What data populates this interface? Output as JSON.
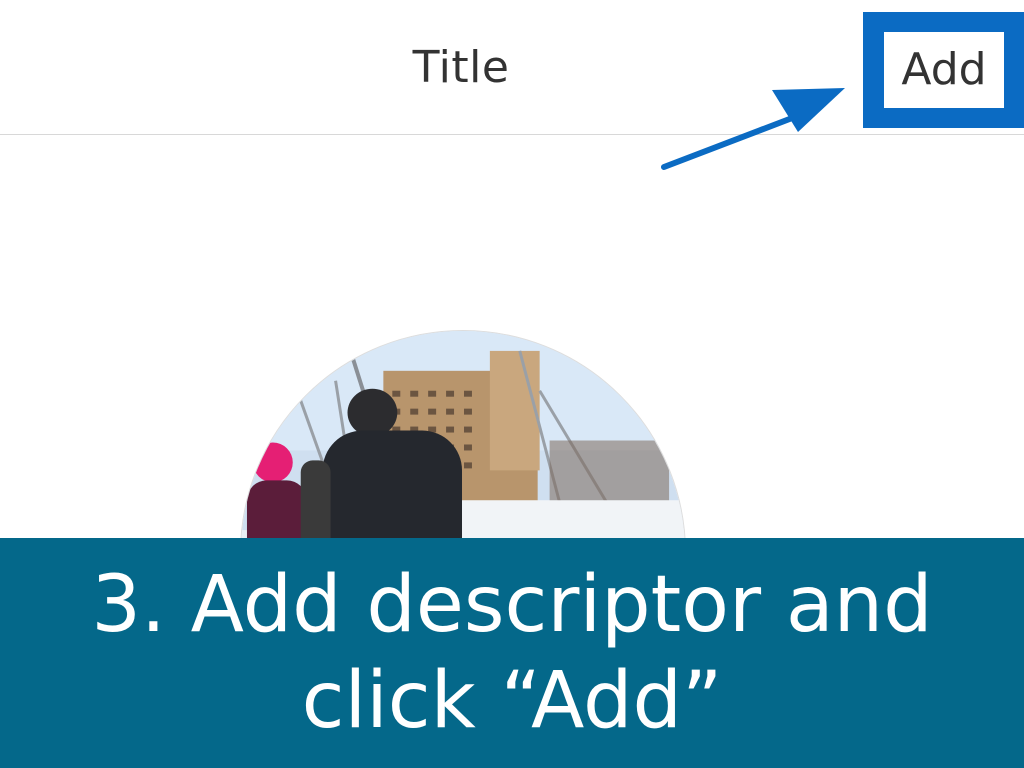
{
  "nav": {
    "title": "Title",
    "add_label": "Add"
  },
  "annotation": {
    "arrow_icon": "arrow-pointing-to-add-icon",
    "highlight_color": "#0b6bc3"
  },
  "photo": {
    "icon": "circular-photo-preview"
  },
  "caption": {
    "line1": "3. Add descriptor and",
    "line2": "click “Add”",
    "background": "#04688a"
  }
}
